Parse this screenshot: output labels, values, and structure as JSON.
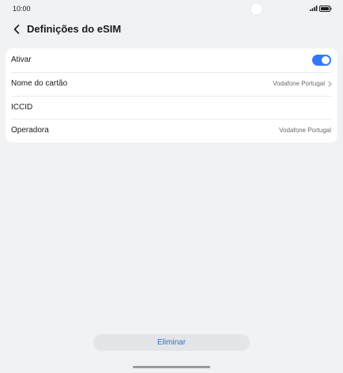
{
  "status_bar": {
    "time": "10:00",
    "signal_icon": "signal-icon",
    "battery_icon": "battery-icon"
  },
  "header": {
    "back_icon": "chevron-left-icon",
    "title": "Definições do eSIM"
  },
  "settings": {
    "activate": {
      "label": "Ativar",
      "enabled": true
    },
    "card_name": {
      "label": "Nome do cartão",
      "value": "Vodafone Portugal"
    },
    "iccid": {
      "label": "ICCID",
      "value": ""
    },
    "operator": {
      "label": "Operadora",
      "value": "Vodafone Portugal"
    }
  },
  "actions": {
    "delete_label": "Eliminar"
  },
  "colors": {
    "accent": "#3478f6",
    "link": "#2d6fd6",
    "background": "#f1f2f4",
    "card": "#ffffff"
  }
}
